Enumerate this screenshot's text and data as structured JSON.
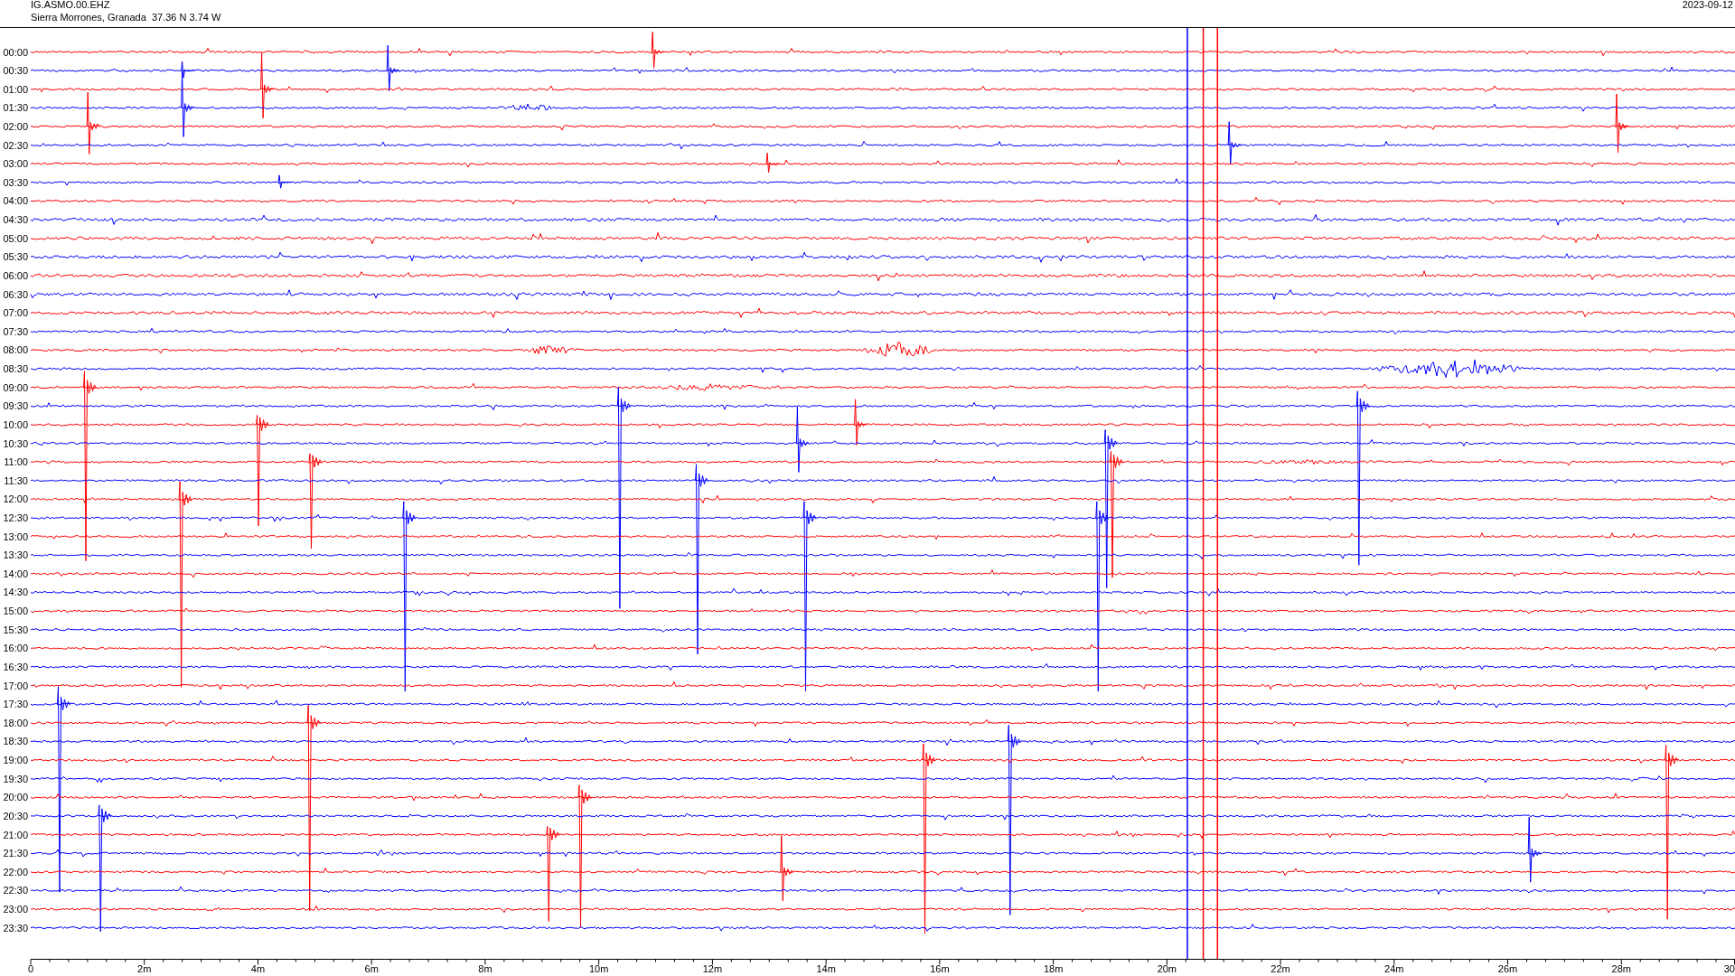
{
  "header": {
    "station": "IG.ASMO.00.EHZ",
    "location": "Sierra Morrones, Granada  37.36 N 3.74 W",
    "date": "2023-09-12"
  },
  "rows": [
    {
      "time": "00:00",
      "color": "#ff0000"
    },
    {
      "time": "00:30",
      "color": "#0000ff"
    },
    {
      "time": "01:00",
      "color": "#ff0000"
    },
    {
      "time": "01:30",
      "color": "#0000ff"
    },
    {
      "time": "02:00",
      "color": "#ff0000"
    },
    {
      "time": "02:30",
      "color": "#0000ff"
    },
    {
      "time": "03:00",
      "color": "#ff0000"
    },
    {
      "time": "03:30",
      "color": "#0000ff"
    },
    {
      "time": "04:00",
      "color": "#ff0000"
    },
    {
      "time": "04:30",
      "color": "#0000ff"
    },
    {
      "time": "05:00",
      "color": "#ff0000"
    },
    {
      "time": "05:30",
      "color": "#0000ff"
    },
    {
      "time": "06:00",
      "color": "#ff0000"
    },
    {
      "time": "06:30",
      "color": "#0000ff"
    },
    {
      "time": "07:00",
      "color": "#ff0000"
    },
    {
      "time": "07:30",
      "color": "#0000ff"
    },
    {
      "time": "08:00",
      "color": "#ff0000"
    },
    {
      "time": "08:30",
      "color": "#0000ff"
    },
    {
      "time": "09:00",
      "color": "#ff0000"
    },
    {
      "time": "09:30",
      "color": "#0000ff"
    },
    {
      "time": "10:00",
      "color": "#ff0000"
    },
    {
      "time": "10:30",
      "color": "#0000ff"
    },
    {
      "time": "11:00",
      "color": "#ff0000"
    },
    {
      "time": "11:30",
      "color": "#0000ff"
    },
    {
      "time": "12:00",
      "color": "#ff0000"
    },
    {
      "time": "12:30",
      "color": "#0000ff"
    },
    {
      "time": "13:00",
      "color": "#ff0000"
    },
    {
      "time": "13:30",
      "color": "#0000ff"
    },
    {
      "time": "14:00",
      "color": "#ff0000"
    },
    {
      "time": "14:30",
      "color": "#0000ff"
    },
    {
      "time": "15:00",
      "color": "#ff0000"
    },
    {
      "time": "15:30",
      "color": "#0000ff"
    },
    {
      "time": "16:00",
      "color": "#ff0000"
    },
    {
      "time": "16:30",
      "color": "#0000ff"
    },
    {
      "time": "17:00",
      "color": "#ff0000"
    },
    {
      "time": "17:30",
      "color": "#0000ff"
    },
    {
      "time": "18:00",
      "color": "#ff0000"
    },
    {
      "time": "18:30",
      "color": "#0000ff"
    },
    {
      "time": "19:00",
      "color": "#ff0000"
    },
    {
      "time": "19:30",
      "color": "#0000ff"
    },
    {
      "time": "20:00",
      "color": "#ff0000"
    },
    {
      "time": "20:30",
      "color": "#0000ff"
    },
    {
      "time": "21:00",
      "color": "#ff0000"
    },
    {
      "time": "21:30",
      "color": "#0000ff"
    },
    {
      "time": "22:00",
      "color": "#ff0000"
    },
    {
      "time": "22:30",
      "color": "#0000ff"
    },
    {
      "time": "23:00",
      "color": "#ff0000"
    },
    {
      "time": "23:30",
      "color": "#0000ff"
    }
  ],
  "x_axis": {
    "labels": [
      "0",
      "2m",
      "4m",
      "6m",
      "8m",
      "10m",
      "12m",
      "14m",
      "16m",
      "18m",
      "20m",
      "22m",
      "24m",
      "26m",
      "28m",
      "30"
    ]
  }
}
